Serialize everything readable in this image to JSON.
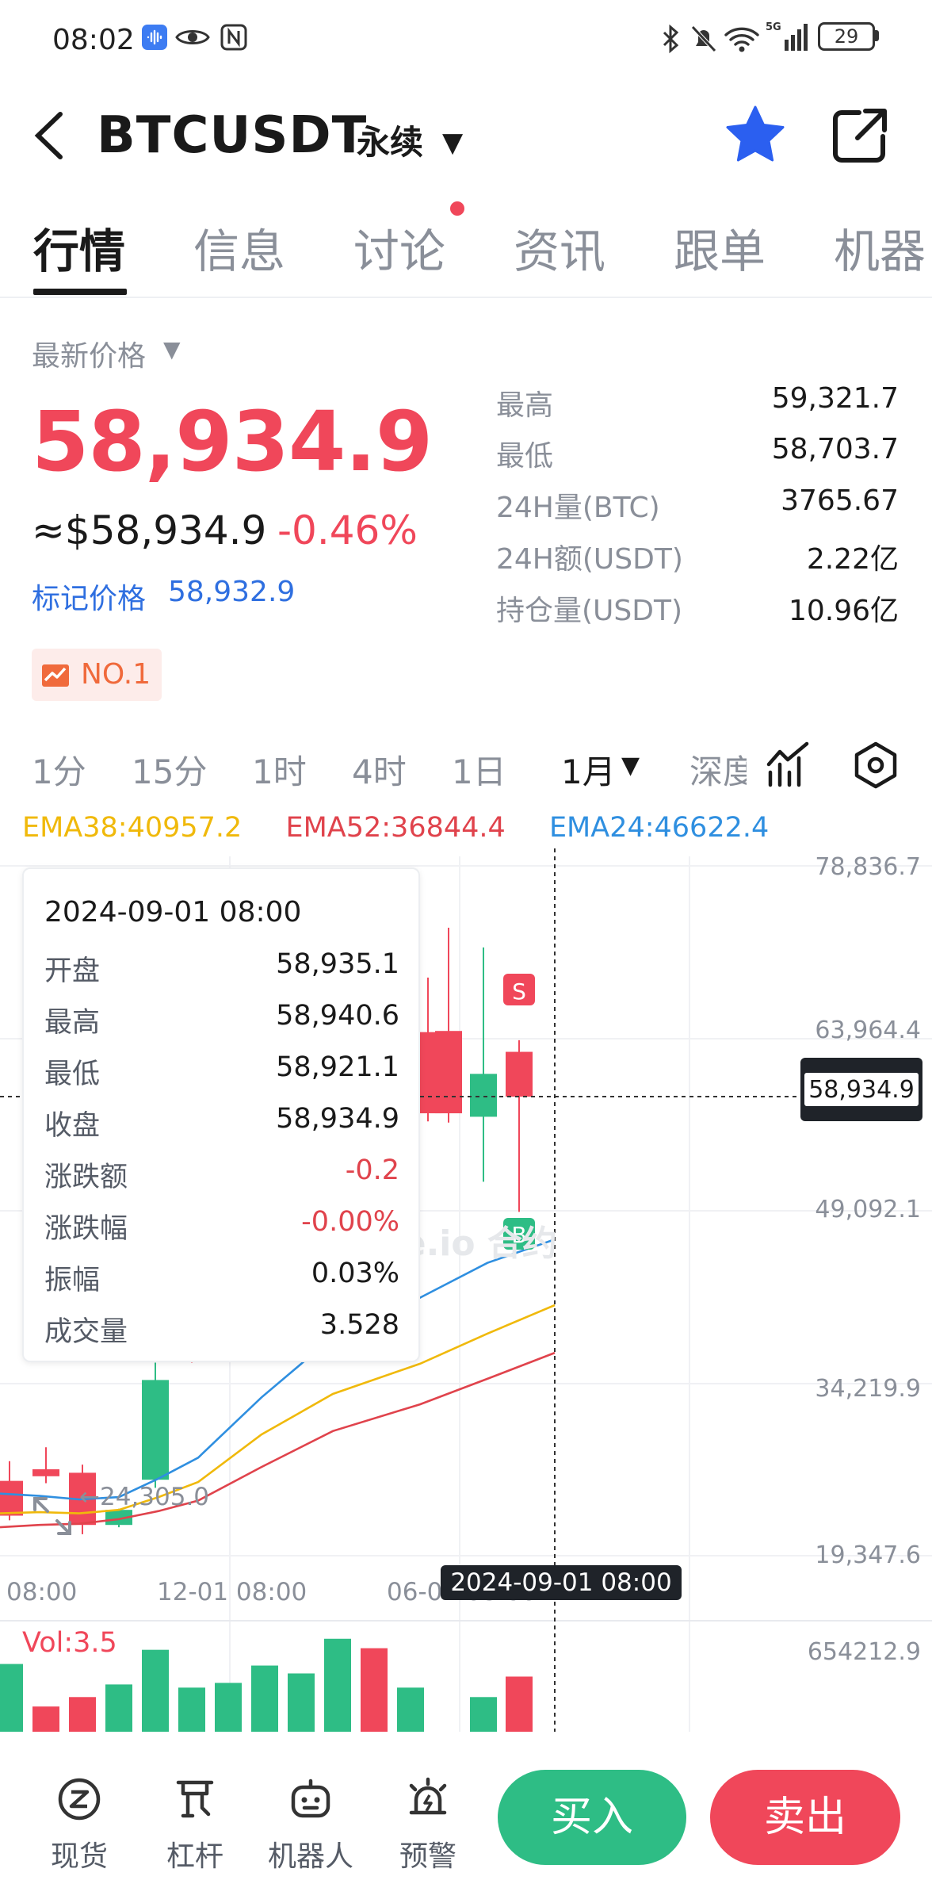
{
  "status_bar": {
    "time": "08:02",
    "battery": "29"
  },
  "header": {
    "title": "BTCUSDT",
    "subtitle": "永续",
    "caret": "▼"
  },
  "tabs": [
    {
      "label": "行情",
      "active": true
    },
    {
      "label": "信息"
    },
    {
      "label": "讨论",
      "badge_dot": true
    },
    {
      "label": "资讯"
    },
    {
      "label": "跟单"
    },
    {
      "label": "机器"
    }
  ],
  "price": {
    "latest_label": "最新价格",
    "last": "58,934.9",
    "usd": "≈$58,934.9",
    "change_pct": "-0.46%",
    "mark_label": "标记价格",
    "mark_value": "58,932.9",
    "rank_badge": "NO.1"
  },
  "stats": [
    {
      "label": "最高",
      "value": "59,321.7"
    },
    {
      "label": "最低",
      "value": "58,703.7"
    },
    {
      "label": "24H量(BTC)",
      "value": "3765.67"
    },
    {
      "label": "24H额(USDT)",
      "value": "2.22亿"
    },
    {
      "label": "持仓量(USDT)",
      "value": "10.96亿"
    }
  ],
  "intervals": [
    {
      "label": "1分"
    },
    {
      "label": "15分"
    },
    {
      "label": "1时"
    },
    {
      "label": "4时"
    },
    {
      "label": "1日"
    },
    {
      "label": "1月",
      "active": true
    },
    {
      "label": "深度"
    }
  ],
  "ema": [
    {
      "label": "EMA38:40957.2",
      "color": "#f0b90b"
    },
    {
      "label": "EMA52:36844.4",
      "color": "#e0434c"
    },
    {
      "label": "EMA24:46622.4",
      "color": "#2f8fe0"
    }
  ],
  "tooltip": {
    "date": "2024-09-01 08:00",
    "rows": [
      {
        "label": "开盘",
        "value": "58,935.1"
      },
      {
        "label": "最高",
        "value": "58,940.6"
      },
      {
        "label": "最低",
        "value": "58,921.1"
      },
      {
        "label": "收盘",
        "value": "58,934.9"
      },
      {
        "label": "涨跌额",
        "value": "-0.2"
      },
      {
        "label": "涨跌幅",
        "value": "-0.00%"
      },
      {
        "label": "振幅",
        "value": "0.03%"
      },
      {
        "label": "成交量",
        "value": "3.528"
      }
    ]
  },
  "chart": {
    "y_ticks": [
      "78,836.7",
      "63,964.4",
      "49,092.1",
      "34,219.9",
      "19,347.6"
    ],
    "x_ticks": [
      "08:00",
      "12-01 08:00",
      "06-01 08:00"
    ],
    "crosshair_time": "2024-09-01 08:00",
    "crosshair_price": "58,934.9",
    "min_ref": "←24,305.0",
    "markers": {
      "sell": "S",
      "buy": "B"
    },
    "vol_label": "Vol:3.5",
    "vol_max": "654212.9"
  },
  "chart_data": {
    "type": "candlestick",
    "y_range": [
      19347.6,
      78836.7
    ],
    "candles": [
      {
        "o": 25800,
        "h": 27500,
        "l": 22400,
        "c": 22800
      },
      {
        "o": 26800,
        "h": 28700,
        "l": 25600,
        "c": 26200
      },
      {
        "o": 26500,
        "h": 27200,
        "l": 21200,
        "c": 22000
      },
      {
        "o": 22000,
        "h": 23400,
        "l": 21800,
        "c": 23300
      },
      {
        "o": 25900,
        "h": 36000,
        "l": 25200,
        "c": 34500
      },
      {
        "o": 37500,
        "h": 38500,
        "l": 36000,
        "c": 36400
      },
      {
        "o": 64500,
        "h": 69200,
        "l": 56800,
        "c": 57500
      },
      {
        "o": 64600,
        "h": 73500,
        "l": 56700,
        "c": 57500
      },
      {
        "o": 57200,
        "h": 71800,
        "l": 51600,
        "c": 60900
      },
      {
        "o": 62800,
        "h": 63800,
        "l": 49000,
        "c": 58934.9
      }
    ],
    "ema24": [
      24700,
      24500,
      24200,
      24400,
      26000,
      27800,
      33000,
      38200,
      41600,
      44600,
      46622.4
    ],
    "ema38": [
      23000,
      23100,
      23000,
      23300,
      24400,
      25700,
      29800,
      33300,
      35900,
      38500,
      40957.2
    ],
    "ema52": [
      21800,
      22000,
      22100,
      22500,
      23200,
      24100,
      27000,
      30100,
      32400,
      34600,
      36844.4
    ],
    "volume": [
      430000,
      160000,
      220000,
      300000,
      520000,
      280000,
      310000,
      420000,
      370000,
      590000,
      530000,
      280000,
      220000,
      350000
    ]
  },
  "bottom_nav": [
    {
      "label": "现货"
    },
    {
      "label": "杠杆"
    },
    {
      "label": "机器人"
    },
    {
      "label": "预警"
    }
  ],
  "actions": {
    "buy": "买入",
    "sell": "卖出"
  }
}
